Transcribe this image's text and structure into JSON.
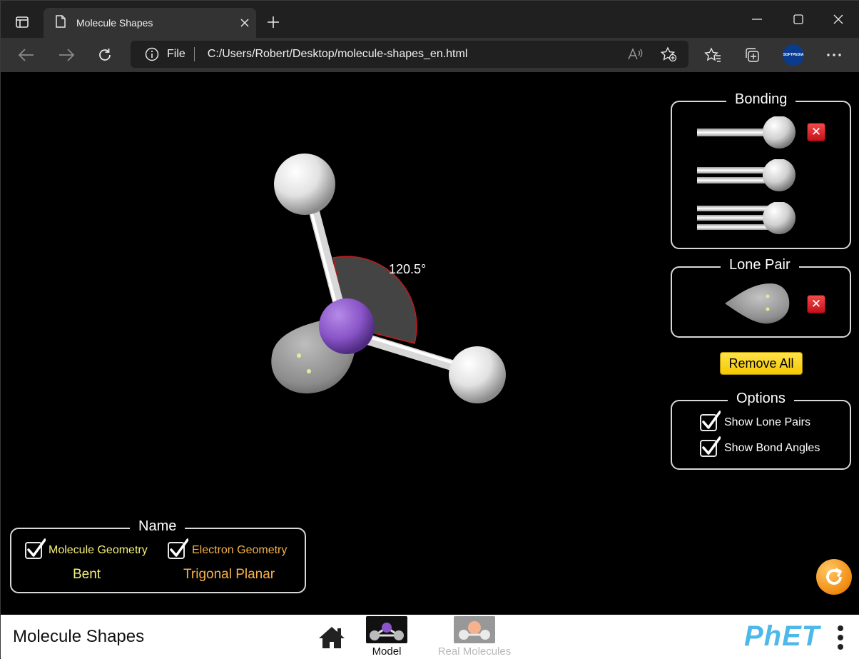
{
  "browser": {
    "tab_title": "Molecule Shapes",
    "file_label": "File",
    "url": "C:/Users/Robert/Desktop/molecule-shapes_en.html",
    "profile_label": "SOFTPEDIA"
  },
  "bonding": {
    "title": "Bonding",
    "options": [
      {
        "kind": "single-bond",
        "removable": true
      },
      {
        "kind": "double-bond",
        "removable": false
      },
      {
        "kind": "triple-bond",
        "removable": false
      }
    ]
  },
  "lone_pair": {
    "title": "Lone Pair",
    "removable": true
  },
  "remove_all_label": "Remove All",
  "options_panel": {
    "title": "Options",
    "show_lone_pairs": {
      "label": "Show Lone Pairs",
      "checked": true
    },
    "show_bond_angles": {
      "label": "Show Bond Angles",
      "checked": true
    }
  },
  "name_panel": {
    "title": "Name",
    "molecule_geometry": {
      "label": "Molecule Geometry",
      "checked": true,
      "value": "Bent",
      "color": "#f7f07a"
    },
    "electron_geometry": {
      "label": "Electron Geometry",
      "checked": true,
      "value": "Trigonal Planar",
      "color": "#f6b24a"
    }
  },
  "molecule": {
    "bond_angle_label": "120.5°",
    "central_atom_color": "#8a55c8",
    "outer_atom_color": "#eeeeee"
  },
  "navbar": {
    "sim_title": "Molecule Shapes",
    "screens": [
      {
        "label": "Model",
        "selected": true
      },
      {
        "label": "Real Molecules",
        "selected": false
      }
    ],
    "brand": "PhET"
  }
}
